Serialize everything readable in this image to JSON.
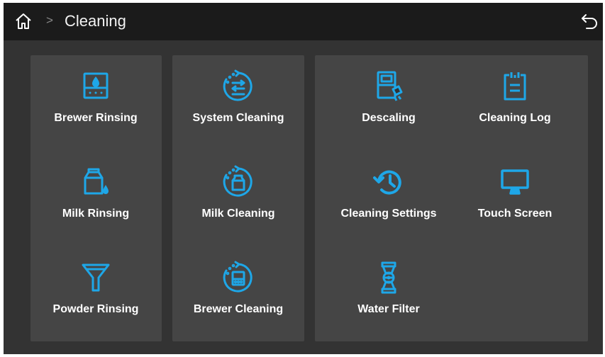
{
  "header": {
    "title": "Cleaning",
    "separator": ">"
  },
  "colors": {
    "accent": "#1ea7e8",
    "panel": "#454545",
    "background": "#333333",
    "topbar": "#1b1b1b"
  },
  "items": [
    {
      "label": "Brewer Rinsing",
      "icon": "brewer-rinsing-icon"
    },
    {
      "label": "Milk Rinsing",
      "icon": "milk-rinsing-icon"
    },
    {
      "label": "Powder Rinsing",
      "icon": "funnel-icon"
    },
    {
      "label": "System Cleaning",
      "icon": "system-cleaning-icon"
    },
    {
      "label": "Milk Cleaning",
      "icon": "milk-cleaning-icon"
    },
    {
      "label": "Brewer Cleaning",
      "icon": "brewer-cleaning-icon"
    },
    {
      "label": "Descaling",
      "icon": "descaling-icon"
    },
    {
      "label": "Cleaning Log",
      "icon": "clipboard-icon"
    },
    {
      "label": "Cleaning Settings",
      "icon": "history-icon"
    },
    {
      "label": "Touch Screen",
      "icon": "monitor-icon"
    },
    {
      "label": "Water Filter",
      "icon": "water-filter-icon"
    }
  ]
}
